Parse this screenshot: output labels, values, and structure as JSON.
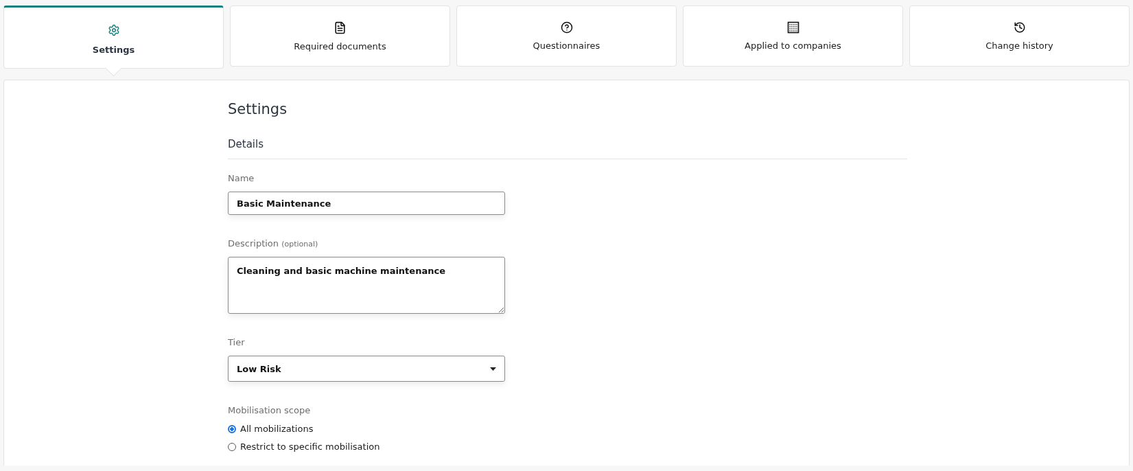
{
  "tabs": [
    {
      "label": "Settings",
      "selected": true
    },
    {
      "label": "Required documents",
      "selected": false
    },
    {
      "label": "Questionnaires",
      "selected": false
    },
    {
      "label": "Applied to companies",
      "selected": false
    },
    {
      "label": "Change history",
      "selected": false
    }
  ],
  "page_title": "Settings",
  "section_title": "Details",
  "name_field": {
    "label": "Name",
    "value": "Basic Maintenance"
  },
  "description_field": {
    "label": "Description",
    "hint": "(optional)",
    "value": "Cleaning and basic machine maintenance"
  },
  "tier_field": {
    "label": "Tier",
    "value": "Low Risk"
  },
  "mobilisation_scope": {
    "label": "Mobilisation scope",
    "options": [
      {
        "label": "All mobilizations",
        "selected": true
      },
      {
        "label": "Restrict to specific mobilisation",
        "selected": false
      }
    ]
  }
}
